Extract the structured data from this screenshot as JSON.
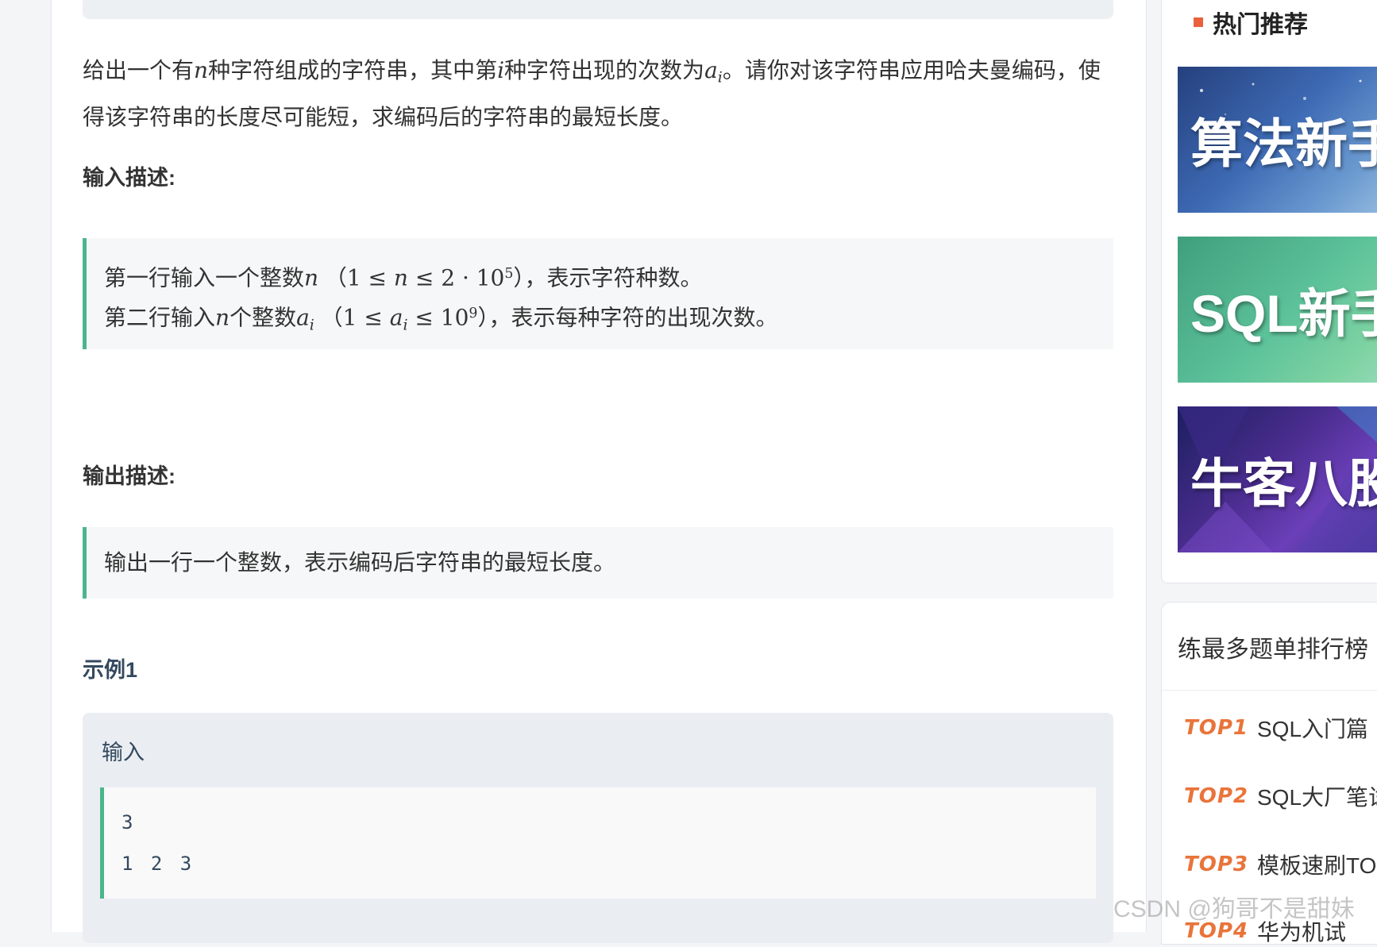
{
  "description": {
    "p1": "给出一个有",
    "var_n": "n",
    "p2": "种字符组成的字符串，其中第",
    "var_i": "i",
    "p3": "种字符出现的次数为",
    "var_a": "a",
    "sub_i": "i",
    "p4": "。请你对该字符串应用哈夫曼编码，使得该字符串的长度尽可能短，求编码后的字符串的最短长度。"
  },
  "input_section": {
    "title": "输入描述:",
    "line1": {
      "text1": "第一行输入一个整数",
      "var": "n",
      "constraint_left": "（1 ≤ ",
      "constraint_var": "n",
      "constraint_mid": " ≤ 2 · 10",
      "constraint_sup": "5",
      "constraint_right": "）",
      "text2": "，表示字符种数。"
    },
    "line2": {
      "text1": "第二行输入",
      "var": "n",
      "text2": "个整数",
      "var2": "a",
      "var2_sub": "i",
      "constraint_left": "（1 ≤ ",
      "constraint_var": "a",
      "constraint_sub": "i",
      "constraint_mid": " ≤ 10",
      "constraint_sup": "9",
      "constraint_right": "）",
      "text3": "，表示每种字符的出现次数。"
    }
  },
  "output_section": {
    "title": "输出描述:",
    "text": "输出一行一个整数，表示编码后字符串的最短长度。"
  },
  "example": {
    "title": "示例1",
    "input_label": "输入",
    "input_lines": [
      "3",
      "1 2 3"
    ]
  },
  "sidebar": {
    "hot_title": "热门推荐",
    "banners": [
      "算法新手",
      "SQL新手",
      "牛客八股"
    ],
    "ranking_title": "练最多题单排行榜",
    "rankings": [
      {
        "badge": "TOP1",
        "label": "SQL入门篇"
      },
      {
        "badge": "TOP2",
        "label": "SQL大厂笔试"
      },
      {
        "badge": "TOP3",
        "label": "模板速刷TOP"
      },
      {
        "badge": "TOP4",
        "label": "华为机试"
      }
    ]
  },
  "watermark": "CSDN @狗哥不是甜妹",
  "colors": {
    "accent_green": "#4cb58a",
    "rank_orange": "#e9743a",
    "hot_marker": "#e8613c"
  }
}
